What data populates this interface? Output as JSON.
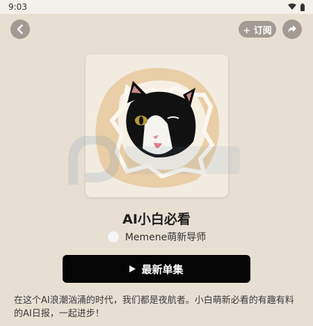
{
  "status_bar": {
    "time": "9:03"
  },
  "header": {
    "subscribe_label": "+ 订阅"
  },
  "podcast": {
    "title": "AI小白必看",
    "author": "Memene萌新导师",
    "play_button_label": "最新单集",
    "description": "在这个AI浪潮汹涌的时代，我们都是夜航者。小白萌新必看的有趣有料的AI日报，一起进步！"
  },
  "colors": {
    "background": "#e8dfd3",
    "button_gray": "#a39b93",
    "primary_button": "#050505"
  },
  "icons": [
    "back-arrow-icon",
    "share-icon",
    "wifi-icon",
    "battery-icon",
    "play-icon"
  ]
}
